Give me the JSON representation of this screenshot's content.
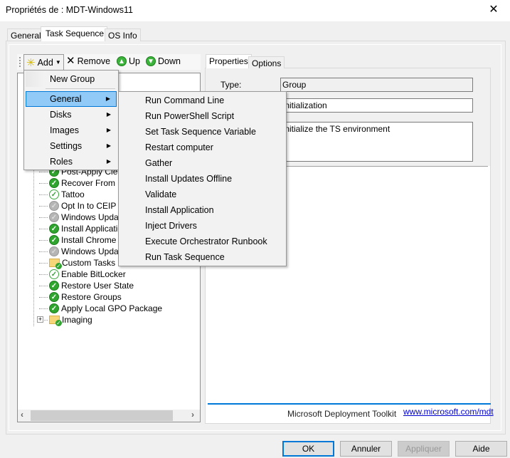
{
  "window": {
    "title": "Propriétés de : MDT-Windows11",
    "close_glyph": "✕"
  },
  "tabs": [
    {
      "label": "General"
    },
    {
      "label": "Task Sequence"
    },
    {
      "label": "OS Info"
    }
  ],
  "toolbar": {
    "add": "Add",
    "remove": "Remove",
    "up": "Up",
    "down": "Down"
  },
  "add_menu": {
    "items": [
      {
        "label": "New Group"
      },
      {
        "label": "General",
        "has_submenu": true,
        "highlighted": true
      },
      {
        "label": "Disks",
        "has_submenu": true
      },
      {
        "label": "Images",
        "has_submenu": true
      },
      {
        "label": "Settings",
        "has_submenu": true
      },
      {
        "label": "Roles",
        "has_submenu": true
      }
    ]
  },
  "general_submenu": {
    "items": [
      "Run Command Line",
      "Run PowerShell Script",
      "Set Task Sequence Variable",
      "Restart computer",
      "Gather",
      "Install Updates Offline",
      "Validate",
      "Install Application",
      "Inject Drivers",
      "Execute Orchestrator Runbook",
      "Run Task Sequence"
    ]
  },
  "tree": {
    "items": [
      {
        "label": "Post-Apply Cleanu",
        "icon": "check"
      },
      {
        "label": "Recover From Do",
        "icon": "check"
      },
      {
        "label": "Tattoo",
        "icon": "check-light"
      },
      {
        "label": "Opt In to CEIP an",
        "icon": "disabled"
      },
      {
        "label": "Windows Update",
        "icon": "disabled"
      },
      {
        "label": "Install Application",
        "icon": "check"
      },
      {
        "label": "Install Chrome",
        "icon": "check"
      },
      {
        "label": "Windows Update",
        "icon": "disabled"
      },
      {
        "label": "Custom Tasks",
        "icon": "folder"
      },
      {
        "label": "Enable BitLocker",
        "icon": "check-light"
      },
      {
        "label": "Restore User State",
        "icon": "check"
      },
      {
        "label": "Restore Groups",
        "icon": "check"
      },
      {
        "label": "Apply Local GPO Package",
        "icon": "check"
      },
      {
        "label": "Imaging",
        "icon": "folder",
        "expander": "+"
      }
    ]
  },
  "properties": {
    "tabs": [
      {
        "label": "Properties"
      },
      {
        "label": "Options"
      }
    ],
    "type_label": "Type:",
    "type_value": "Group",
    "name_value": "Initialization",
    "description_value": "Initialize the TS environment"
  },
  "footer": {
    "text": "Microsoft Deployment Toolkit",
    "link": "www.microsoft.com/mdt"
  },
  "buttons": {
    "ok": "OK",
    "cancel": "Annuler",
    "apply": "Appliquer",
    "help": "Aide"
  },
  "colors": {
    "accent": "#0078d7",
    "highlight": "#91c9f7",
    "check_green": "#2fa52f"
  }
}
